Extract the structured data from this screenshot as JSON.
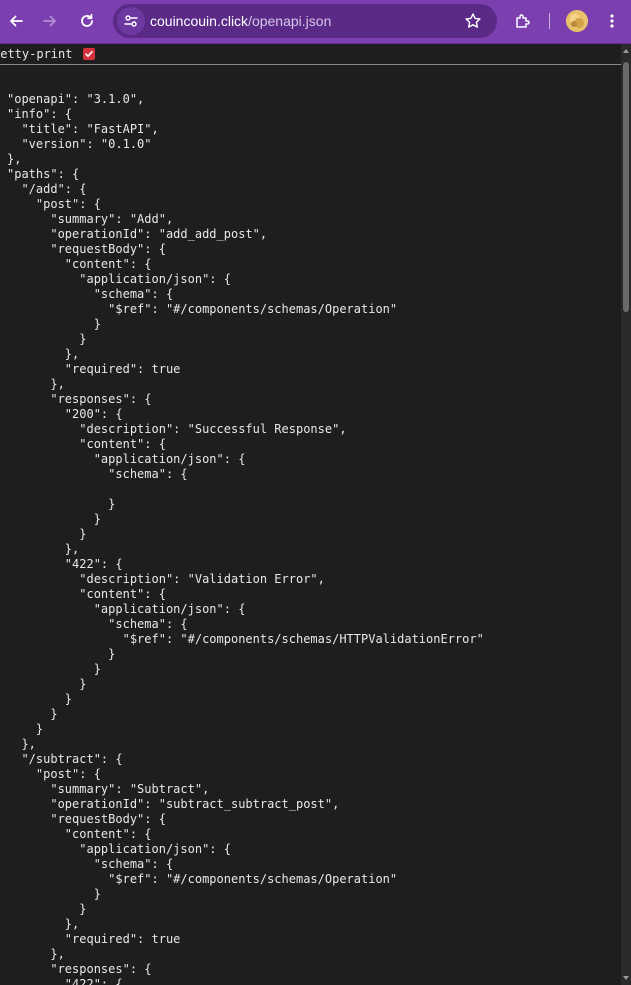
{
  "browser": {
    "url_host": "couincouin.click",
    "url_path": "/openapi.json",
    "accent_color": "#7c3fb0",
    "icons": [
      "back-icon",
      "forward-icon",
      "reload-icon",
      "site-settings-icon",
      "bookmark-star-icon",
      "extensions-icon",
      "profile-avatar",
      "menu-dots-icon"
    ]
  },
  "pretty_print": {
    "label": "retty-print",
    "checked": true
  },
  "json_text": "\"openapi\": \"3.1.0\",\n\"info\": {\n  \"title\": \"FastAPI\",\n  \"version\": \"0.1.0\"\n},\n\"paths\": {\n  \"/add\": {\n    \"post\": {\n      \"summary\": \"Add\",\n      \"operationId\": \"add_add_post\",\n      \"requestBody\": {\n        \"content\": {\n          \"application/json\": {\n            \"schema\": {\n              \"$ref\": \"#/components/schemas/Operation\"\n            }\n          }\n        },\n        \"required\": true\n      },\n      \"responses\": {\n        \"200\": {\n          \"description\": \"Successful Response\",\n          \"content\": {\n            \"application/json\": {\n              \"schema\": {\n\n              }\n            }\n          }\n        },\n        \"422\": {\n          \"description\": \"Validation Error\",\n          \"content\": {\n            \"application/json\": {\n              \"schema\": {\n                \"$ref\": \"#/components/schemas/HTTPValidationError\"\n              }\n            }\n          }\n        }\n      }\n    }\n  },\n  \"/subtract\": {\n    \"post\": {\n      \"summary\": \"Subtract\",\n      \"operationId\": \"subtract_subtract_post\",\n      \"requestBody\": {\n        \"content\": {\n          \"application/json\": {\n            \"schema\": {\n              \"$ref\": \"#/components/schemas/Operation\"\n            }\n          }\n        },\n        \"required\": true\n      },\n      \"responses\": {\n        \"422\": {"
}
